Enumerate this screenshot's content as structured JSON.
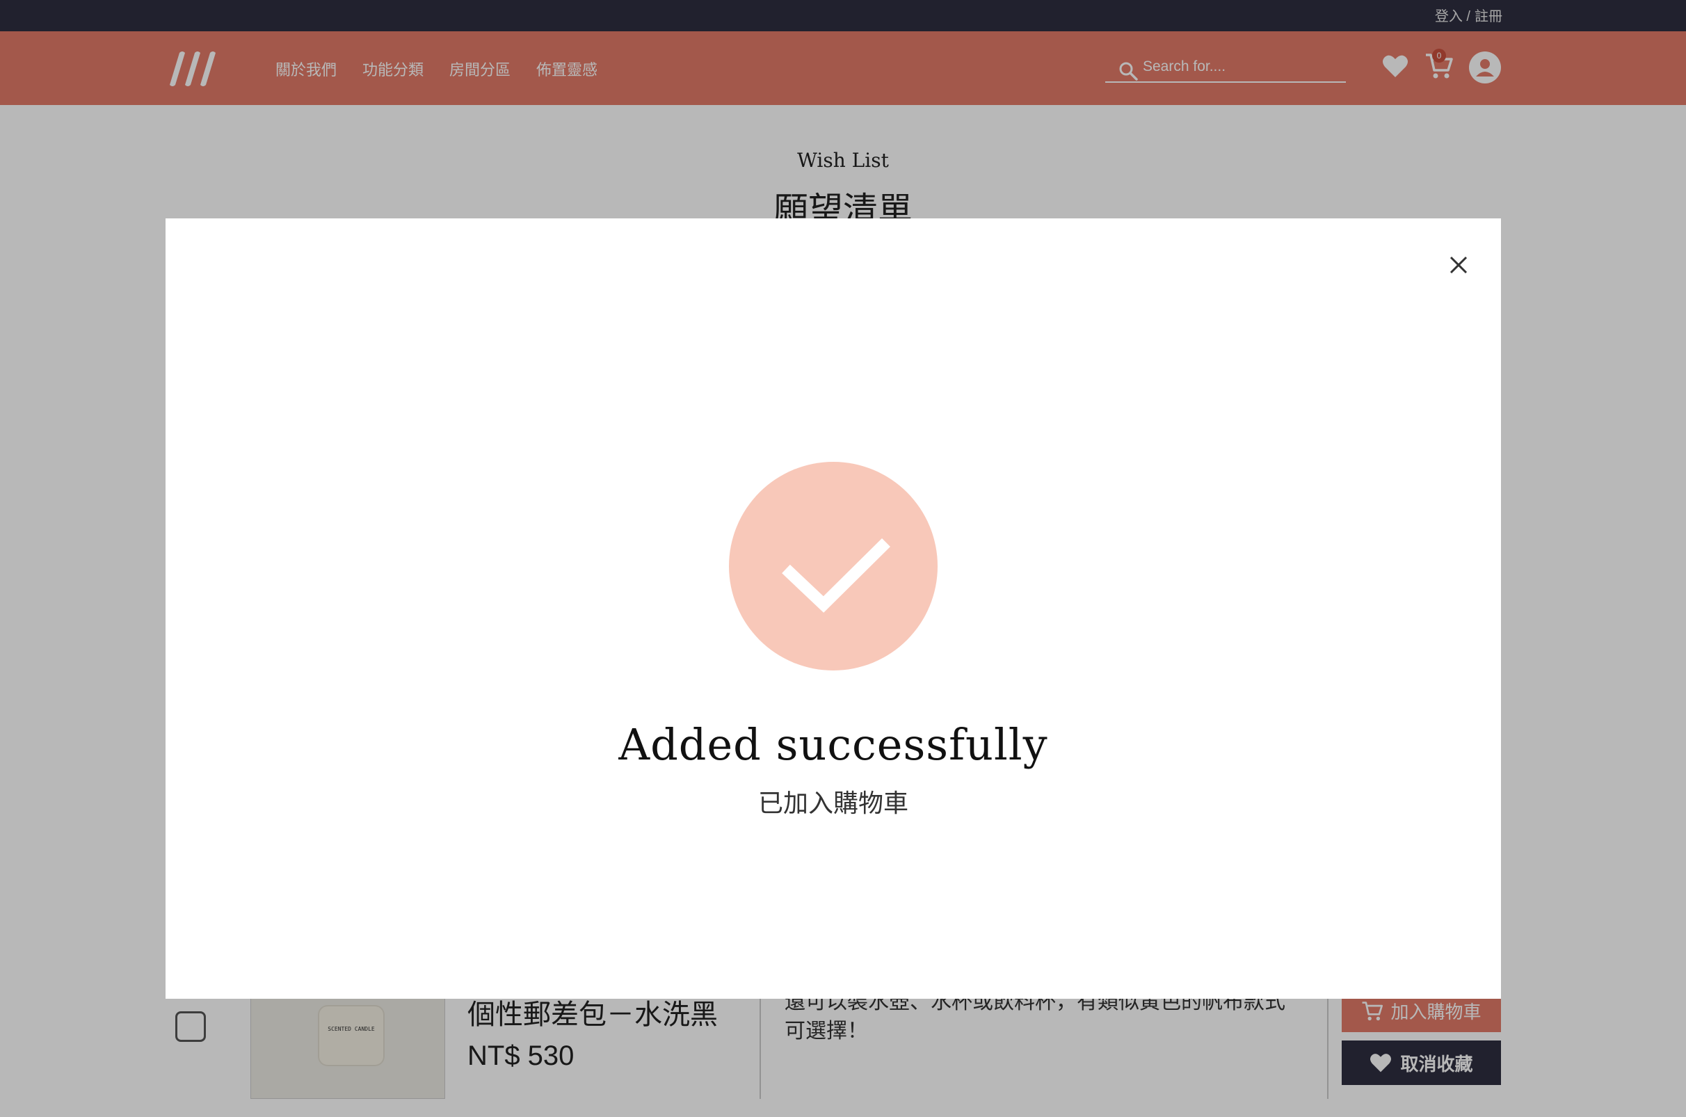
{
  "topbar": {
    "login": "登入 /",
    "register": "註冊"
  },
  "nav": {
    "links": [
      "關於我們",
      "功能分類",
      "房間分區",
      "佈置靈感"
    ],
    "search_placeholder": "Search for....",
    "cart_count": "0"
  },
  "page": {
    "subtitle": "Wish List",
    "title": "願望清單"
  },
  "product": {
    "thumb_label": "SCENTED CANDLE",
    "name": "個性郵差包－水洗黑",
    "price": "NT$ 530",
    "description": "還可以裝水壺、水杯或飲料杯，有類似黃色的帆布款式可選擇！",
    "add_to_cart": "加入購物車",
    "remove_favorite": "取消收藏"
  },
  "modal": {
    "title": "Added successfully",
    "subtitle": "已加入購物車"
  },
  "colors": {
    "topbar": "#2f2e41",
    "brand": "#e27b68",
    "success_circle": "#f8c8b9"
  },
  "icons": [
    "logo-icon",
    "search-icon",
    "heart-icon",
    "cart-icon",
    "user-icon",
    "close-icon",
    "check-icon"
  ]
}
